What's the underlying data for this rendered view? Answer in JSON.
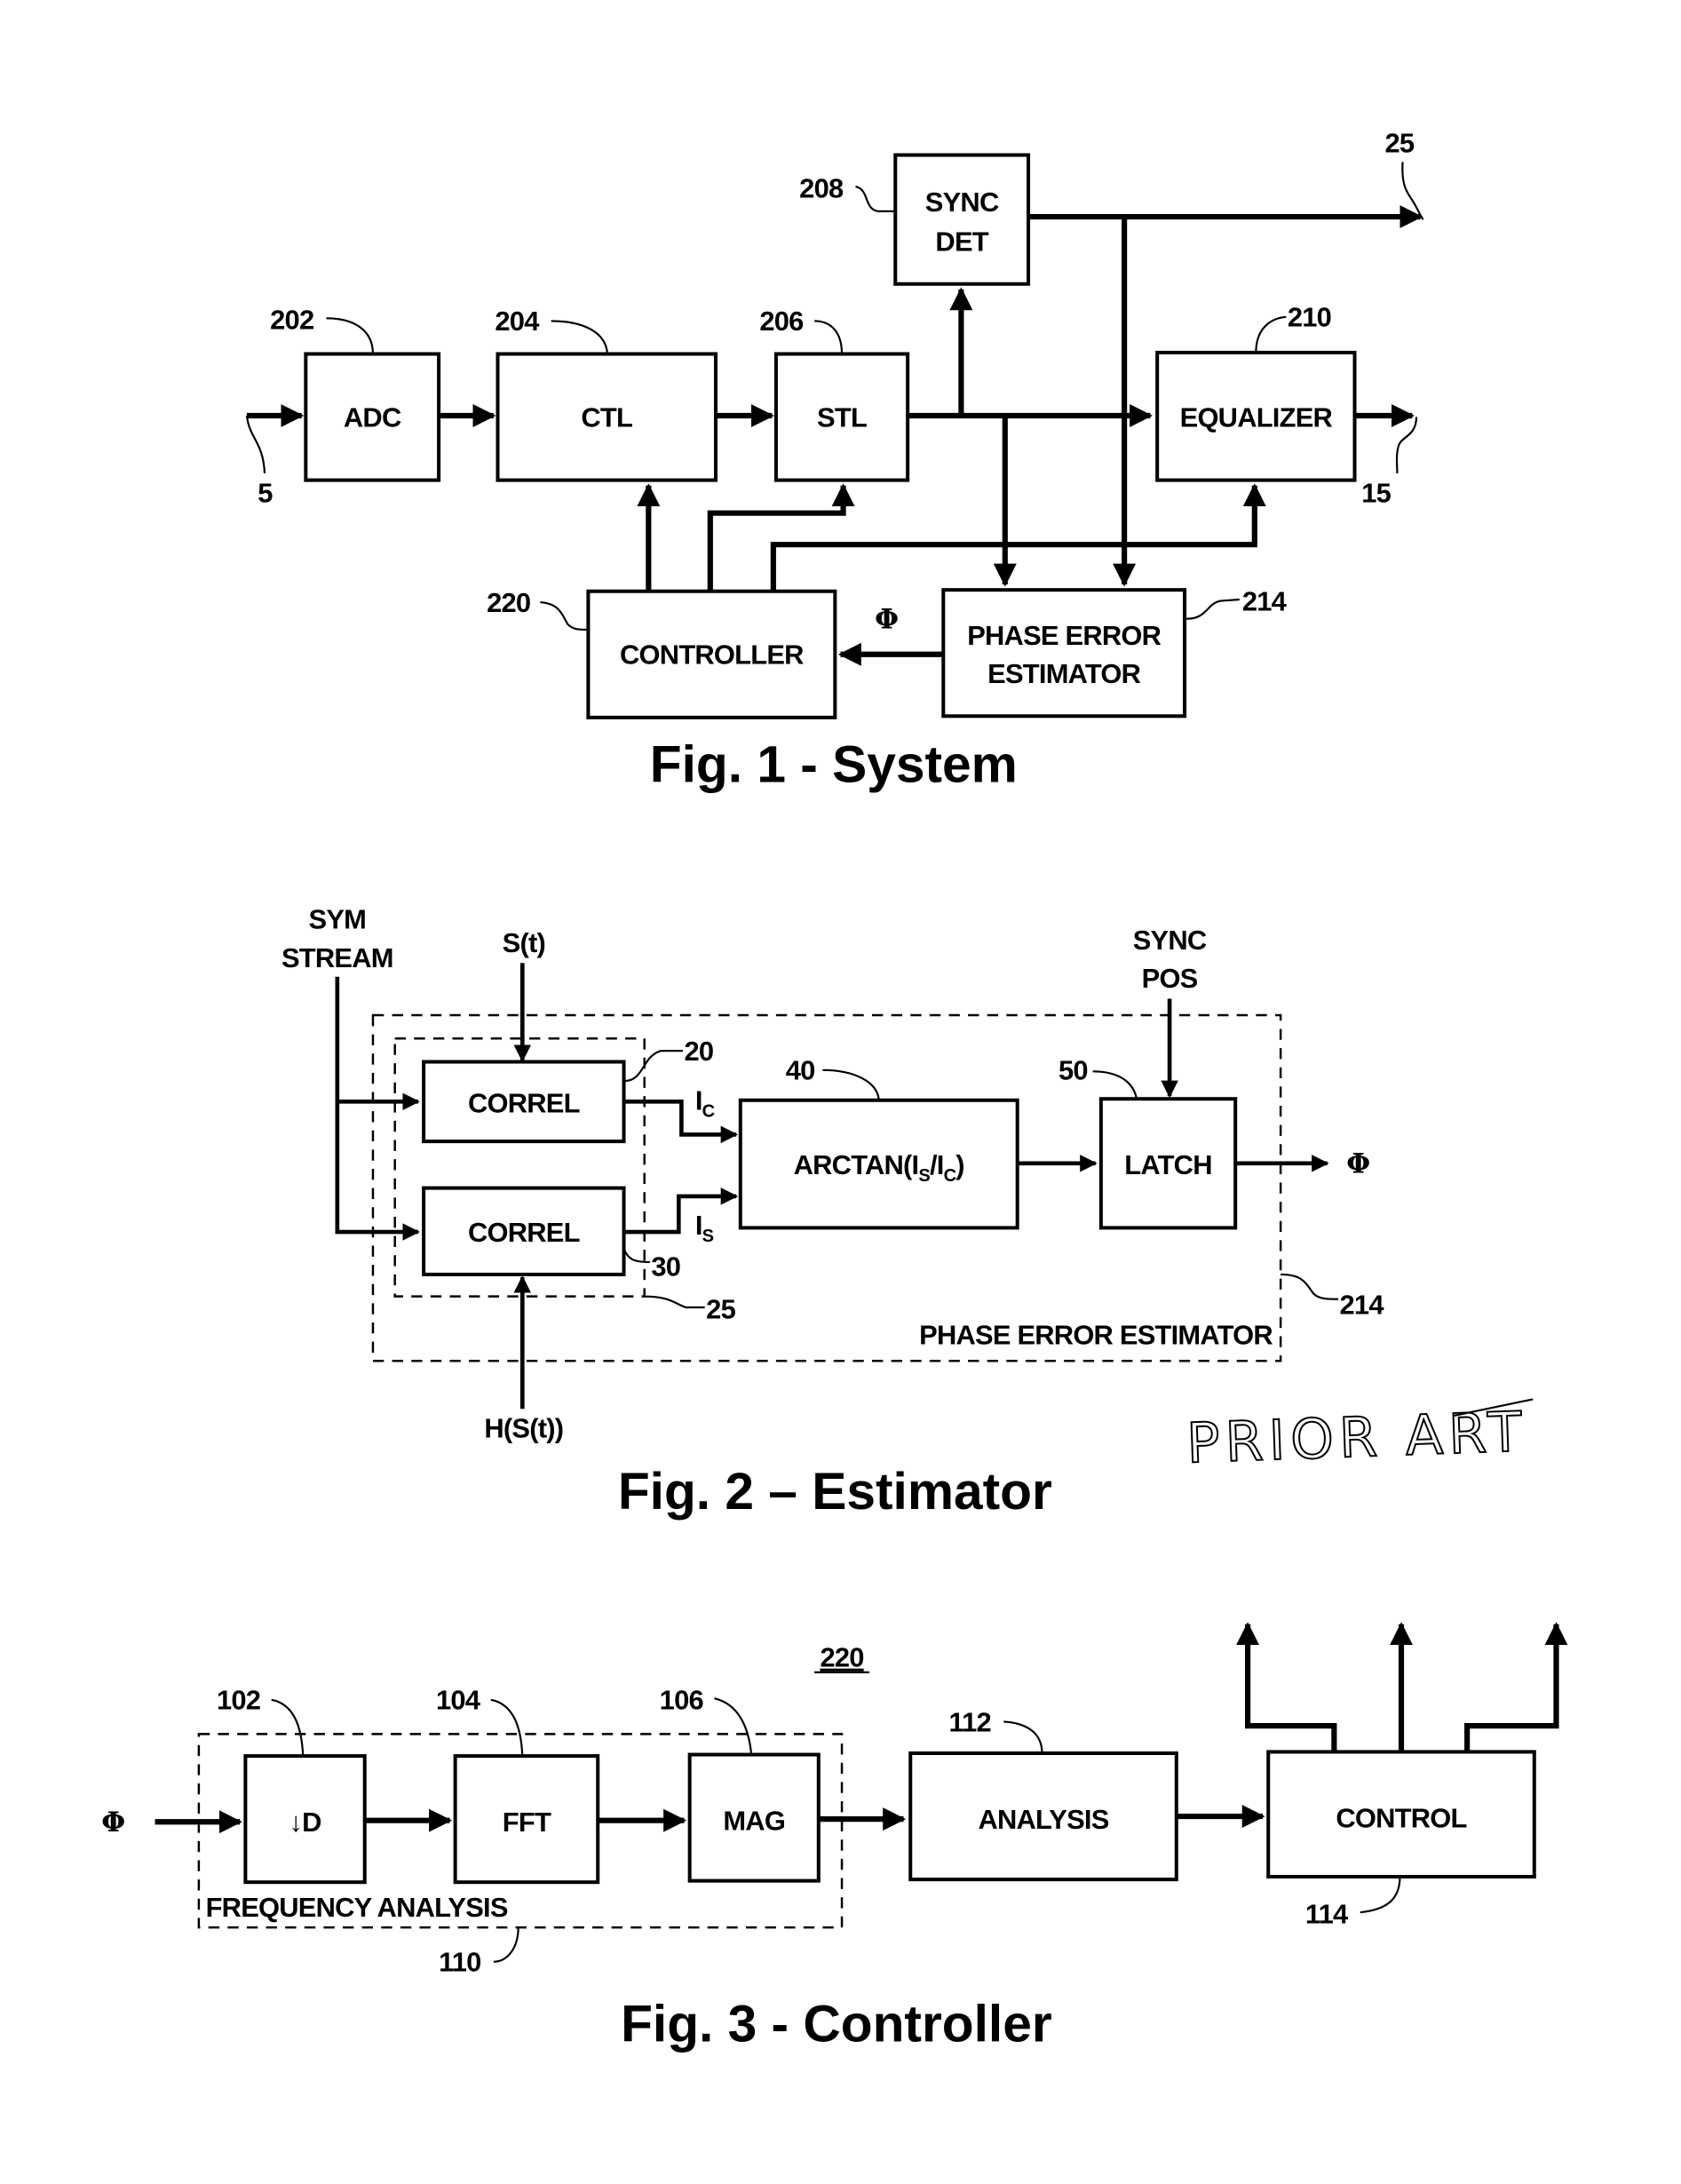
{
  "figures": {
    "fig1": {
      "caption": "Fig.  1 - System",
      "blocks": {
        "adc": {
          "label": "ADC",
          "ref": "202"
        },
        "ctl": {
          "label": "CTL",
          "ref": "204"
        },
        "stl": {
          "label": "STL",
          "ref": "206"
        },
        "sync_det": {
          "line1": "SYNC",
          "line2": "DET",
          "ref": "208"
        },
        "equalizer": {
          "label": "EQUALIZER",
          "ref": "210"
        },
        "controller": {
          "label": "CONTROLLER",
          "ref": "220"
        },
        "phase_error_estimator": {
          "line1": "PHASE ERROR",
          "line2": "ESTIMATOR",
          "ref": "214"
        }
      },
      "signals": {
        "input_ref": "5",
        "sync_output_ref": "25",
        "eq_output_ref": "15",
        "phase_symbol": "Φ"
      }
    },
    "fig2": {
      "caption": "Fig.  2 – Estimator",
      "inputs": {
        "sym_stream_line1": "SYM",
        "sym_stream_line2": "STREAM",
        "s_t": "S(t)",
        "h_s_t": "H(S(t))",
        "sync_pos_line1": "SYNC",
        "sync_pos_line2": "POS"
      },
      "blocks": {
        "correl_top": {
          "label": "CORREL",
          "ref": "20"
        },
        "correl_bottom": {
          "label": "CORREL",
          "ref": "30"
        },
        "correl_group_ref": "25",
        "arctan": {
          "label_pre": "ARCTAN(I",
          "sub1": "S",
          "label_mid": "/I",
          "sub2": "C",
          "label_post": ")",
          "ref": "40"
        },
        "latch": {
          "label": "LATCH",
          "ref": "50"
        },
        "estimator_group": {
          "label": "PHASE ERROR ESTIMATOR",
          "ref": "214"
        }
      },
      "signals": {
        "ic_main": "I",
        "ic_sub": "C",
        "is_main": "I",
        "is_sub": "S",
        "output_symbol": "Φ"
      },
      "annotation": "PRIOR ART"
    },
    "fig3": {
      "caption": "Fig.  3 - Controller",
      "title_ref": "220",
      "input_symbol": "Φ",
      "blocks": {
        "decimate": {
          "label": "↓D",
          "ref": "102"
        },
        "fft": {
          "label": "FFT",
          "ref": "104"
        },
        "mag": {
          "label": "MAG",
          "ref": "106"
        },
        "freq_group": {
          "label": "FREQUENCY ANALYSIS",
          "ref": "110"
        },
        "analysis": {
          "label": "ANALYSIS",
          "ref": "112"
        },
        "control": {
          "label": "CONTROL",
          "ref": "114"
        }
      }
    }
  }
}
